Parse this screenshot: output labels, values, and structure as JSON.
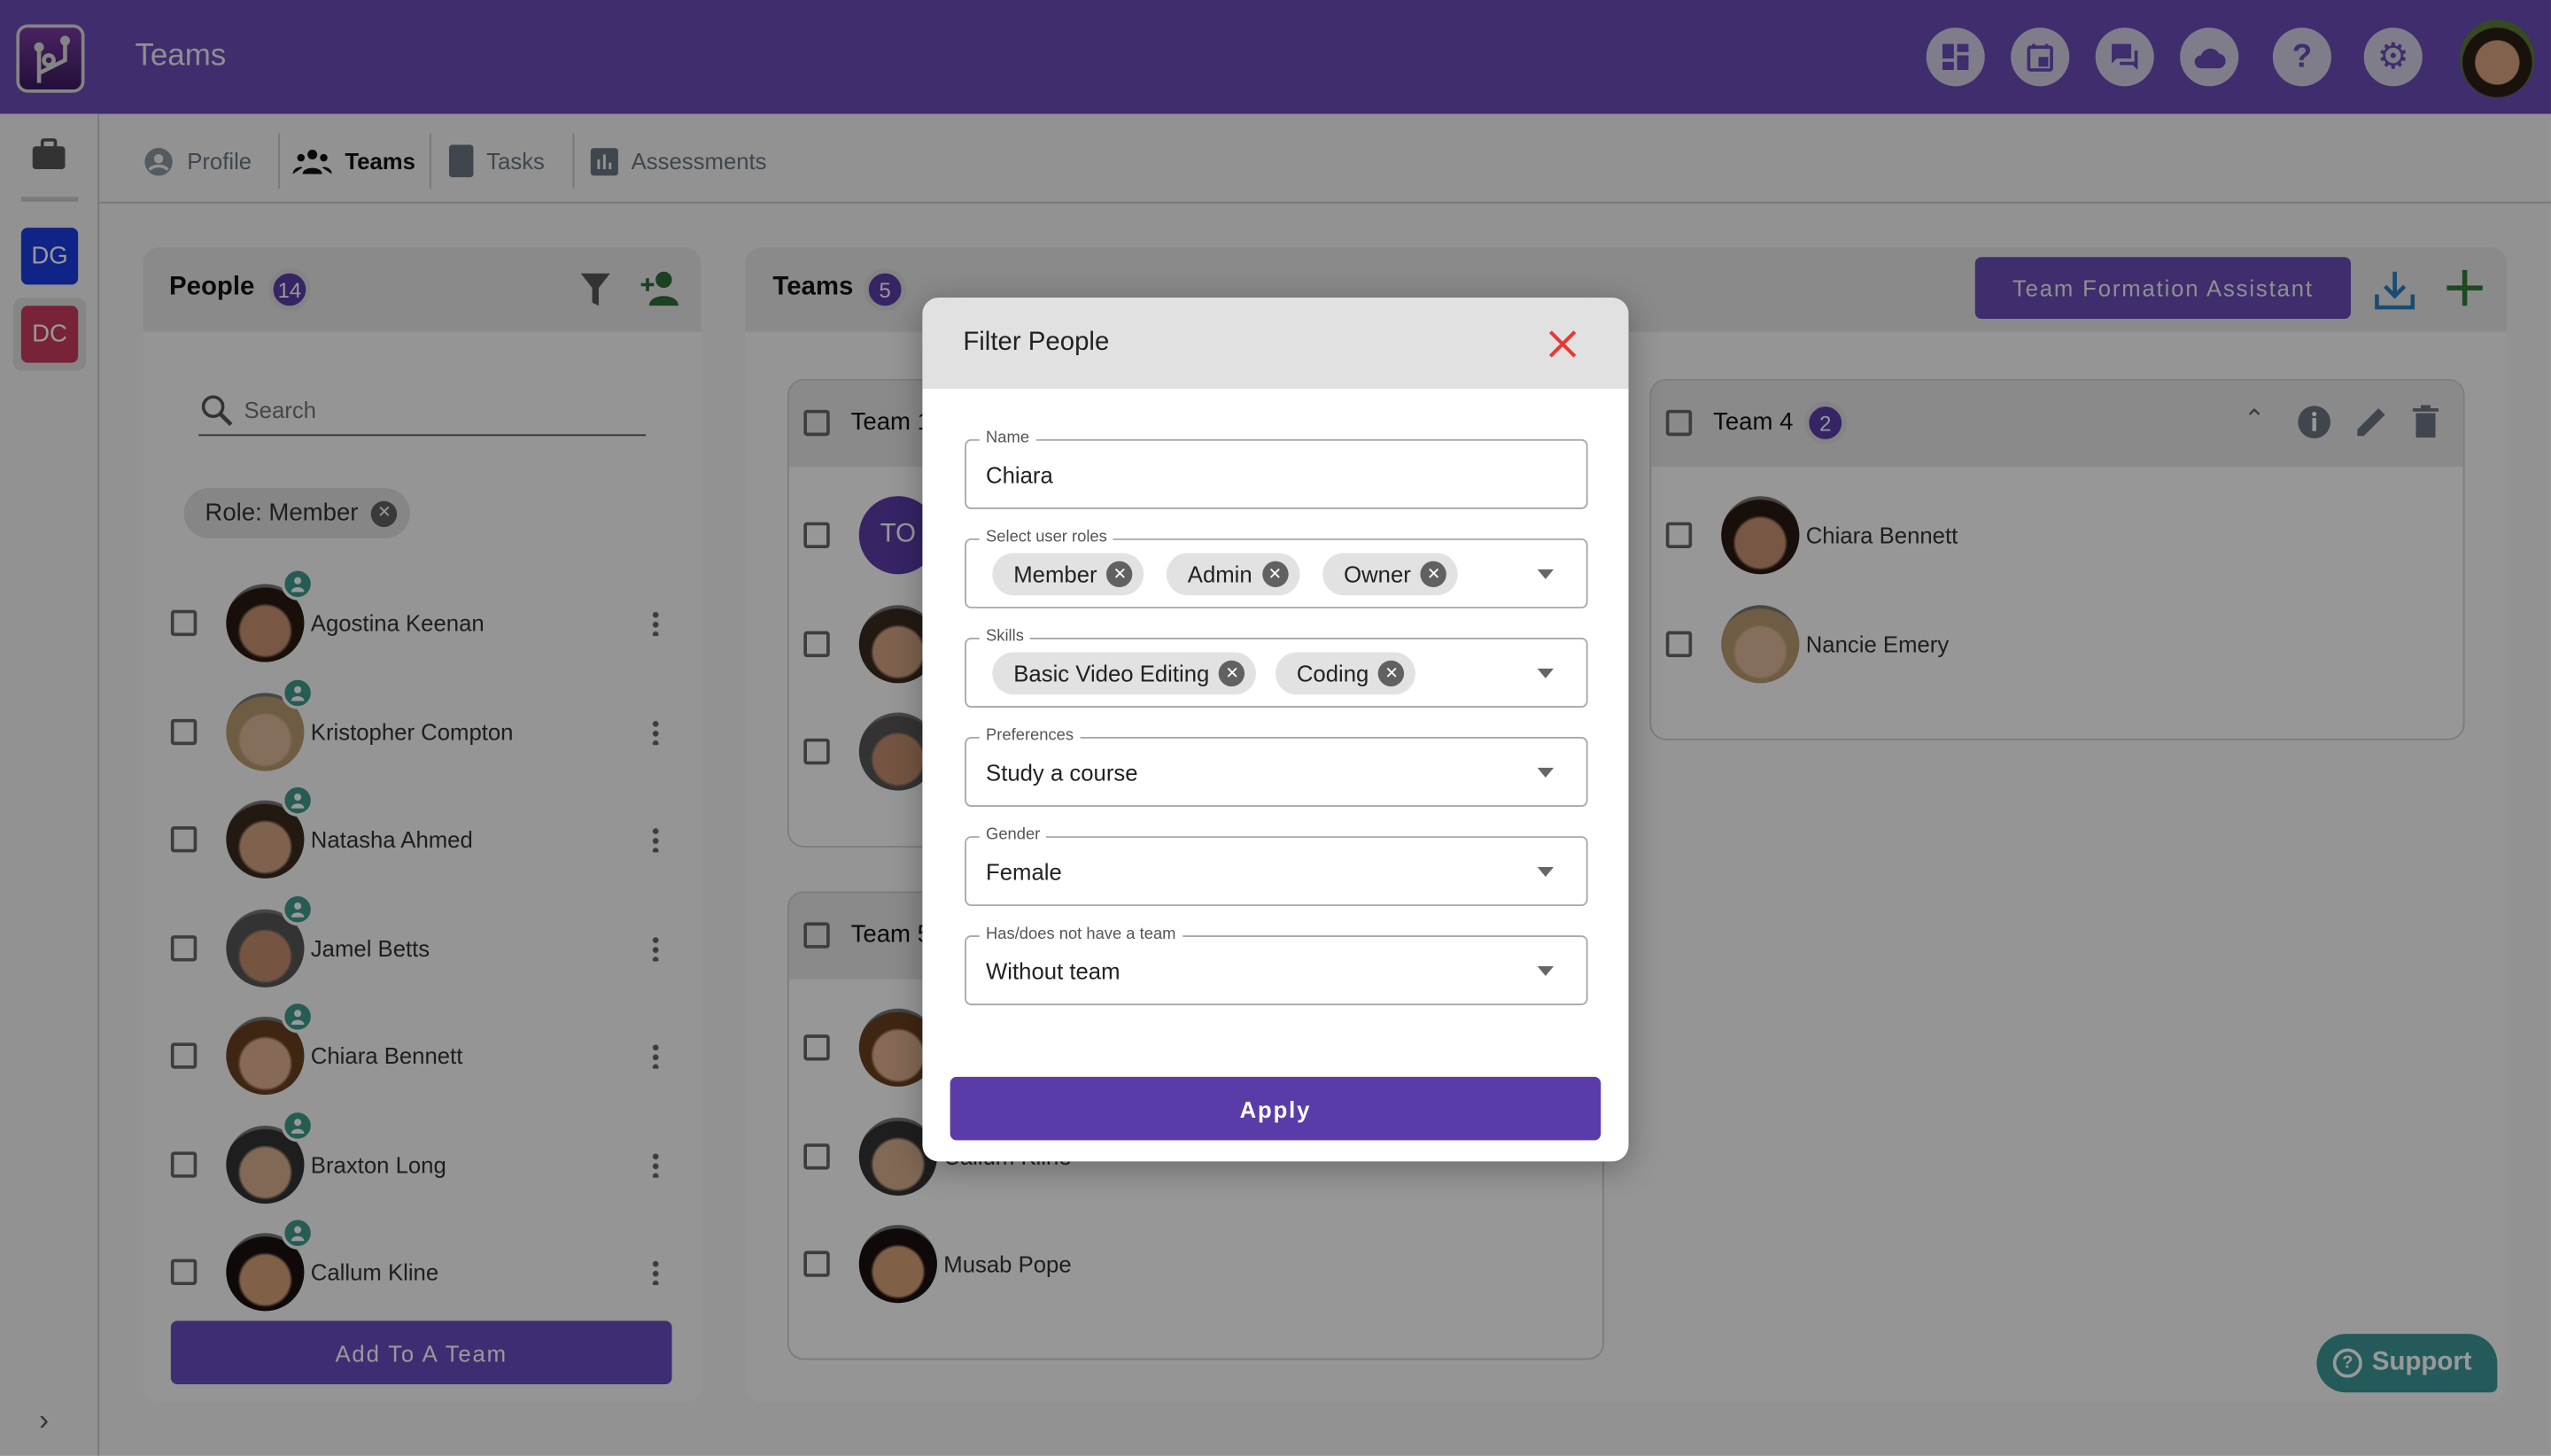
{
  "header": {
    "title": "Teams",
    "icons": [
      "dashboard-icon",
      "calendar-icon",
      "chat-icon",
      "cloud-icon",
      "help-icon",
      "settings-icon"
    ]
  },
  "rail": {
    "workspaces": [
      {
        "initials": "DG",
        "color": "#1a3de0"
      },
      {
        "initials": "DC",
        "color": "#c83b5c"
      }
    ]
  },
  "tabs": [
    {
      "label": "Profile",
      "icon": "account-circle-icon"
    },
    {
      "label": "Teams",
      "icon": "groups-icon",
      "active": true
    },
    {
      "label": "Tasks",
      "icon": "book-icon"
    },
    {
      "label": "Assessments",
      "icon": "chart-icon"
    }
  ],
  "people": {
    "title": "People",
    "count": "14",
    "search_placeholder": "Search",
    "filter_chip": "Role: Member",
    "add_button": "Add To A Team",
    "list": [
      "Agostina Keenan",
      "Kristopher Compton",
      "Natasha Ahmed",
      "Jamel Betts",
      "Chiara Bennett",
      "Braxton Long",
      "Callum Kline"
    ]
  },
  "teams": {
    "title": "Teams",
    "count": "5",
    "assistant_button": "Team Formation Assistant",
    "cards": [
      {
        "title": "Team 1",
        "members": [
          {
            "initials": "TO"
          },
          {
            "name": ""
          },
          {
            "name": ""
          }
        ]
      },
      {
        "title": "Team 5",
        "members": [
          {
            "name": ""
          },
          {
            "name": "Callum Kline"
          },
          {
            "name": "Musab Pope"
          }
        ]
      },
      {
        "title": "Team 4",
        "count": "2",
        "members": [
          {
            "name": "Chiara Bennett"
          },
          {
            "name": "Nancie Emery"
          }
        ]
      }
    ]
  },
  "modal": {
    "title": "Filter People",
    "name": {
      "label": "Name",
      "value": "Chiara"
    },
    "roles": {
      "label": "Select user roles",
      "chips": [
        "Member",
        "Admin",
        "Owner"
      ]
    },
    "skills": {
      "label": "Skills",
      "chips": [
        "Basic Video Editing",
        "Coding"
      ]
    },
    "preferences": {
      "label": "Preferences",
      "value": "Study a course"
    },
    "gender": {
      "label": "Gender",
      "value": "Female"
    },
    "team": {
      "label": "Has/does not have a team",
      "value": "Without team"
    },
    "apply": "Apply"
  },
  "support": "Support",
  "colors": {
    "brand": "#6a4bb7",
    "primary_button": "#5a3ca8",
    "close": "#e53935",
    "support": "#3d9797"
  }
}
